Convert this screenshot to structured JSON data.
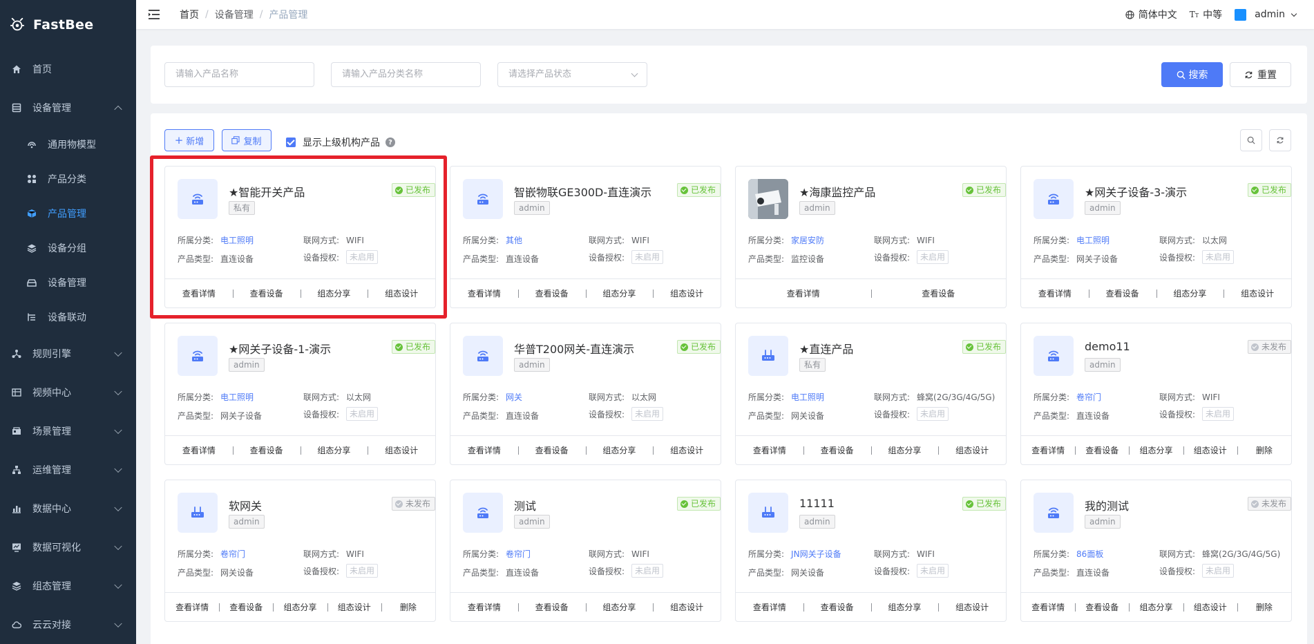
{
  "app": {
    "name": "FastBee"
  },
  "sidebar": {
    "items": [
      {
        "label": "首页",
        "icon": "home-icon",
        "chevron": ""
      },
      {
        "label": "设备管理",
        "icon": "device-manage-icon",
        "chevron": "up"
      },
      {
        "label": "规则引擎",
        "icon": "rule-engine-icon",
        "chevron": "down"
      },
      {
        "label": "视频中心",
        "icon": "video-icon",
        "chevron": "down"
      },
      {
        "label": "场景管理",
        "icon": "scene-icon",
        "chevron": "down"
      },
      {
        "label": "运维管理",
        "icon": "ops-icon",
        "chevron": "down"
      },
      {
        "label": "数据中心",
        "icon": "data-center-icon",
        "chevron": "down"
      },
      {
        "label": "数据可视化",
        "icon": "visualization-icon",
        "chevron": "down"
      },
      {
        "label": "组态管理",
        "icon": "scada-icon",
        "chevron": "down"
      },
      {
        "label": "云云对接",
        "icon": "cloud-icon",
        "chevron": "down"
      }
    ],
    "sub": [
      {
        "label": "通用物模型"
      },
      {
        "label": "产品分类"
      },
      {
        "label": "产品管理"
      },
      {
        "label": "设备分组"
      },
      {
        "label": "设备管理"
      },
      {
        "label": "设备联动"
      }
    ]
  },
  "header": {
    "breadcrumb": [
      "首页",
      "设备管理",
      "产品管理"
    ],
    "language": "简体中文",
    "size": "中等",
    "user": "admin"
  },
  "search": {
    "name_placeholder": "请输入产品名称",
    "category_placeholder": "请输入产品分类名称",
    "status_placeholder": "请选择产品状态",
    "search_label": "搜索",
    "reset_label": "重置"
  },
  "toolbar": {
    "add_label": "新增",
    "copy_label": "复制",
    "show_parent_label": "显示上级机构产品",
    "help": "?"
  },
  "labels": {
    "category": "所属分类:",
    "network": "联网方式:",
    "product_type": "产品类型:",
    "auth": "设备授权:"
  },
  "cards": [
    {
      "title": "★智能开关产品",
      "tag": "私有",
      "status": "已发布",
      "category": "电工照明",
      "network": "WIFI",
      "type": "直连设备",
      "auth": "未启用",
      "actions": [
        "查看详情",
        "查看设备",
        "组态分享",
        "组态设计"
      ]
    },
    {
      "title": "智嵌物联GE300D-直连演示",
      "tag": "admin",
      "status": "已发布",
      "category": "其他",
      "network": "WIFI",
      "type": "直连设备",
      "auth": "未启用",
      "actions": [
        "查看详情",
        "查看设备",
        "组态分享",
        "组态设计"
      ]
    },
    {
      "title": "★海康监控产品",
      "tag": "admin",
      "status": "已发布",
      "category": "家居安防",
      "network": "WIFI",
      "type": "监控设备",
      "auth": "未启用",
      "actions": [
        "查看详情",
        "查看设备"
      ]
    },
    {
      "title": "★网关子设备-3-演示",
      "tag": "admin",
      "status": "已发布",
      "category": "电工照明",
      "network": "以太网",
      "type": "网关子设备",
      "auth": "未启用",
      "actions": [
        "查看详情",
        "查看设备",
        "组态分享",
        "组态设计"
      ]
    },
    {
      "title": "★网关子设备-1-演示",
      "tag": "admin",
      "status": "已发布",
      "category": "电工照明",
      "network": "以太网",
      "type": "网关子设备",
      "auth": "未启用",
      "actions": [
        "查看详情",
        "查看设备",
        "组态分享",
        "组态设计"
      ]
    },
    {
      "title": "华普T200网关-直连演示",
      "tag": "admin",
      "status": "已发布",
      "category": "网关",
      "network": "以太网",
      "type": "直连设备",
      "auth": "未启用",
      "actions": [
        "查看详情",
        "查看设备",
        "组态分享",
        "组态设计"
      ]
    },
    {
      "title": "★直连产品",
      "tag": "私有",
      "status": "已发布",
      "category": "电工照明",
      "network": "蜂窝(2G/3G/4G/5G)",
      "type": "网关设备",
      "auth": "未启用",
      "actions": [
        "查看详情",
        "查看设备",
        "组态分享",
        "组态设计"
      ]
    },
    {
      "title": "demo11",
      "tag": "admin",
      "status": "未发布",
      "category": "卷帘门",
      "network": "WIFI",
      "type": "直连设备",
      "auth": "未启用",
      "actions": [
        "查看详情",
        "查看设备",
        "组态分享",
        "组态设计",
        "删除"
      ]
    },
    {
      "title": "软网关",
      "tag": "admin",
      "status": "未发布",
      "category": "卷帘门",
      "network": "WIFI",
      "type": "网关设备",
      "auth": "未启用",
      "actions": [
        "查看详情",
        "查看设备",
        "组态分享",
        "组态设计",
        "删除"
      ]
    },
    {
      "title": "测试",
      "tag": "admin",
      "status": "已发布",
      "category": "卷帘门",
      "network": "WIFI",
      "type": "直连设备",
      "auth": "未启用",
      "actions": [
        "查看详情",
        "查看设备",
        "组态分享",
        "组态设计"
      ]
    },
    {
      "title": "11111",
      "tag": "admin",
      "status": "已发布",
      "category": "JN网关子设备",
      "network": "WIFI",
      "type": "网关设备",
      "auth": "未启用",
      "actions": [
        "查看详情",
        "查看设备",
        "组态分享",
        "组态设计"
      ]
    },
    {
      "title": "我的测试",
      "tag": "admin",
      "status": "未发布",
      "category": "86面板",
      "network": "蜂窝(2G/3G/4G/5G)",
      "type": "直连设备",
      "auth": "未启用",
      "actions": [
        "查看详情",
        "查看设备",
        "组态分享",
        "组态设计",
        "删除"
      ]
    }
  ],
  "card_icons": [
    "wifi-router-icon",
    "wifi-router-icon",
    "camera-photo",
    "wifi-router-icon",
    "wifi-router-icon",
    "wifi-router-icon",
    "gateway-router-icon",
    "wifi-router-icon",
    "gateway-router-icon",
    "wifi-router-icon",
    "gateway-router-icon",
    "wifi-router-icon"
  ],
  "colors": {
    "accent": "#4e7af7",
    "sidebar_bg": "#1f2d3d",
    "highlight": "#e5212b",
    "published": "#67c23a"
  }
}
